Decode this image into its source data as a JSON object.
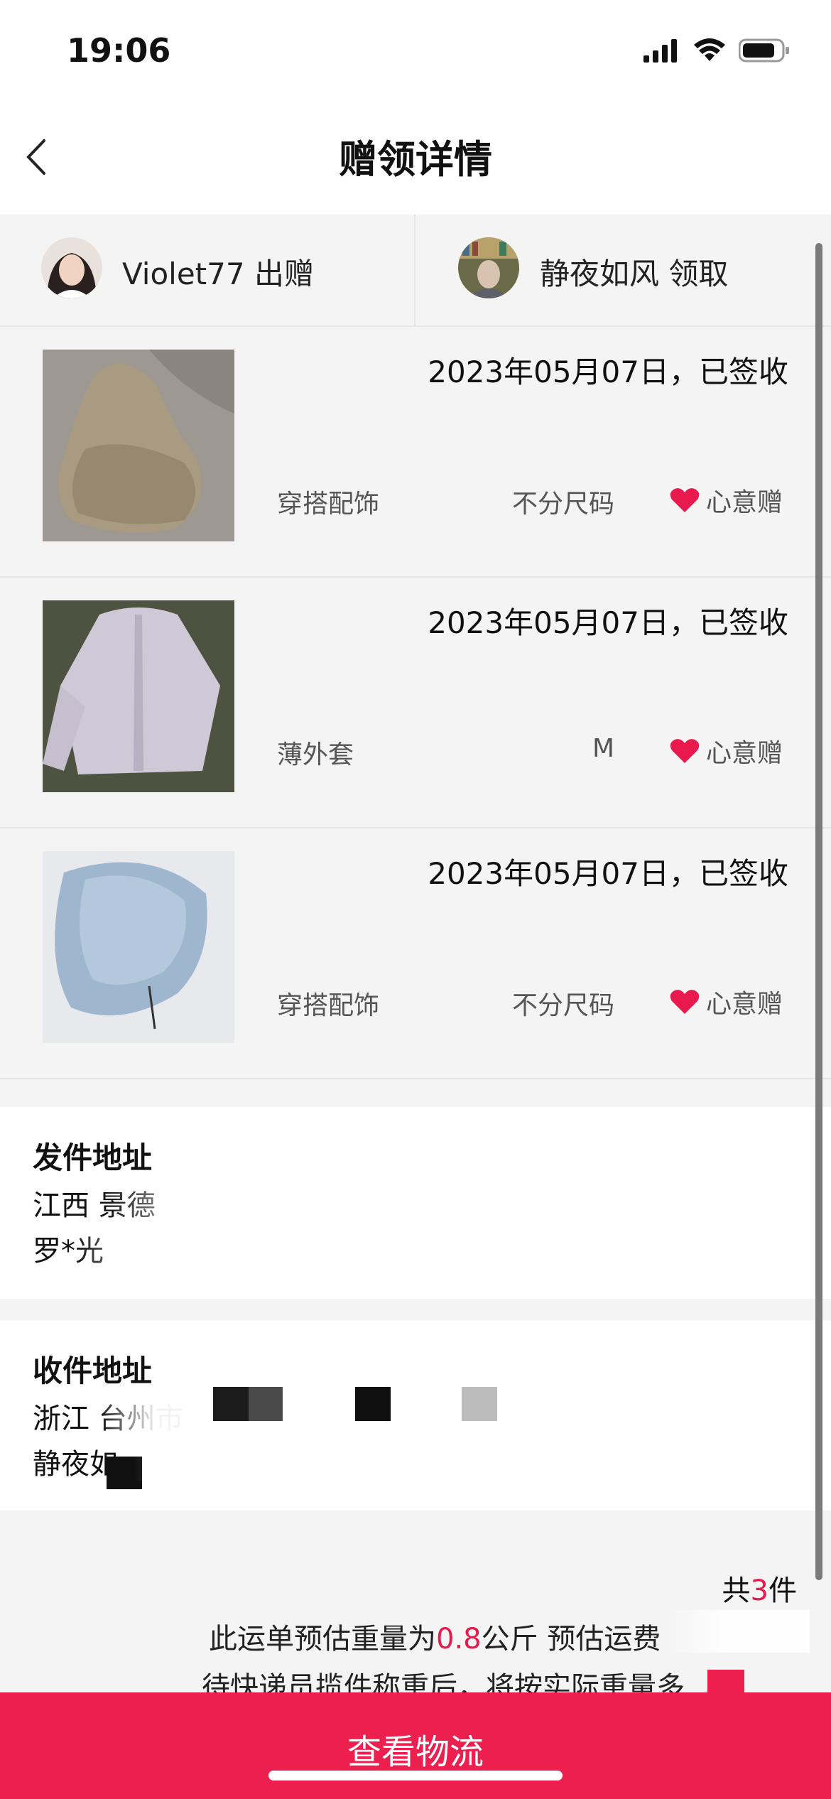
{
  "status_bar": {
    "time": "19:06"
  },
  "nav": {
    "title": "赠领详情"
  },
  "people": {
    "giver": "Violet77 出赠",
    "receiver": "静夜如风 领取"
  },
  "items": [
    {
      "date_status": "2023年05月07日，已签收",
      "category": "穿搭配饰",
      "size": "不分尺码",
      "tag": "心意赠"
    },
    {
      "date_status": "2023年05月07日，已签收",
      "category": "薄外套",
      "size": "M",
      "tag": "心意赠"
    },
    {
      "date_status": "2023年05月07日，已签收",
      "category": "穿搭配饰",
      "size": "不分尺码",
      "tag": "心意赠"
    }
  ],
  "sender_address": {
    "title": "发件地址",
    "line1": "江西 景德",
    "line2": "罗*光"
  },
  "receiver_address": {
    "title": "收件地址",
    "line1": "浙江 台州市",
    "line2": "静夜如"
  },
  "summary": {
    "total_prefix": "共",
    "total_count": "3",
    "total_suffix": "件",
    "weight_prefix": "此运单预估重量为",
    "weight_value": "0.8",
    "weight_suffix": "公斤   预估运费",
    "pending_text": "待快递员揽件称重后，将按实际重量多"
  },
  "action": {
    "view_logistics": "查看物流"
  },
  "colors": {
    "accent": "#ec1f4f",
    "heart": "#e8194c",
    "background": "#f4f4f4"
  },
  "icons": {
    "back": "chevron-left-icon",
    "signal": "signal-icon",
    "wifi": "wifi-icon",
    "battery": "battery-icon",
    "heart": "heart-icon"
  }
}
